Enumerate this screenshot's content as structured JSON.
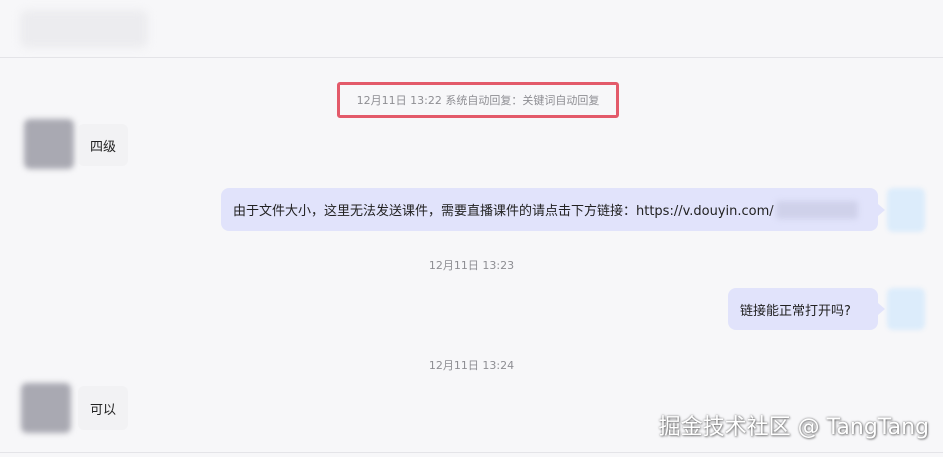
{
  "header": {
    "contact_name": ""
  },
  "system_message": {
    "text": "12月11日 13:22 系统自动回复：关键词自动回复"
  },
  "messages": [
    {
      "side": "left",
      "text": "四级"
    },
    {
      "side": "right",
      "text": "由于文件大小，这里无法发送课件，需要直播课件的请点击下方链接：https://v.douyin.com/"
    },
    {
      "side": "right",
      "text": "链接能正常打开吗?"
    },
    {
      "side": "left",
      "text": "可以"
    }
  ],
  "timestamps": [
    "12月11日 13:23",
    "12月11日 13:24"
  ],
  "watermark": "掘金技术社区 @ TangTang"
}
